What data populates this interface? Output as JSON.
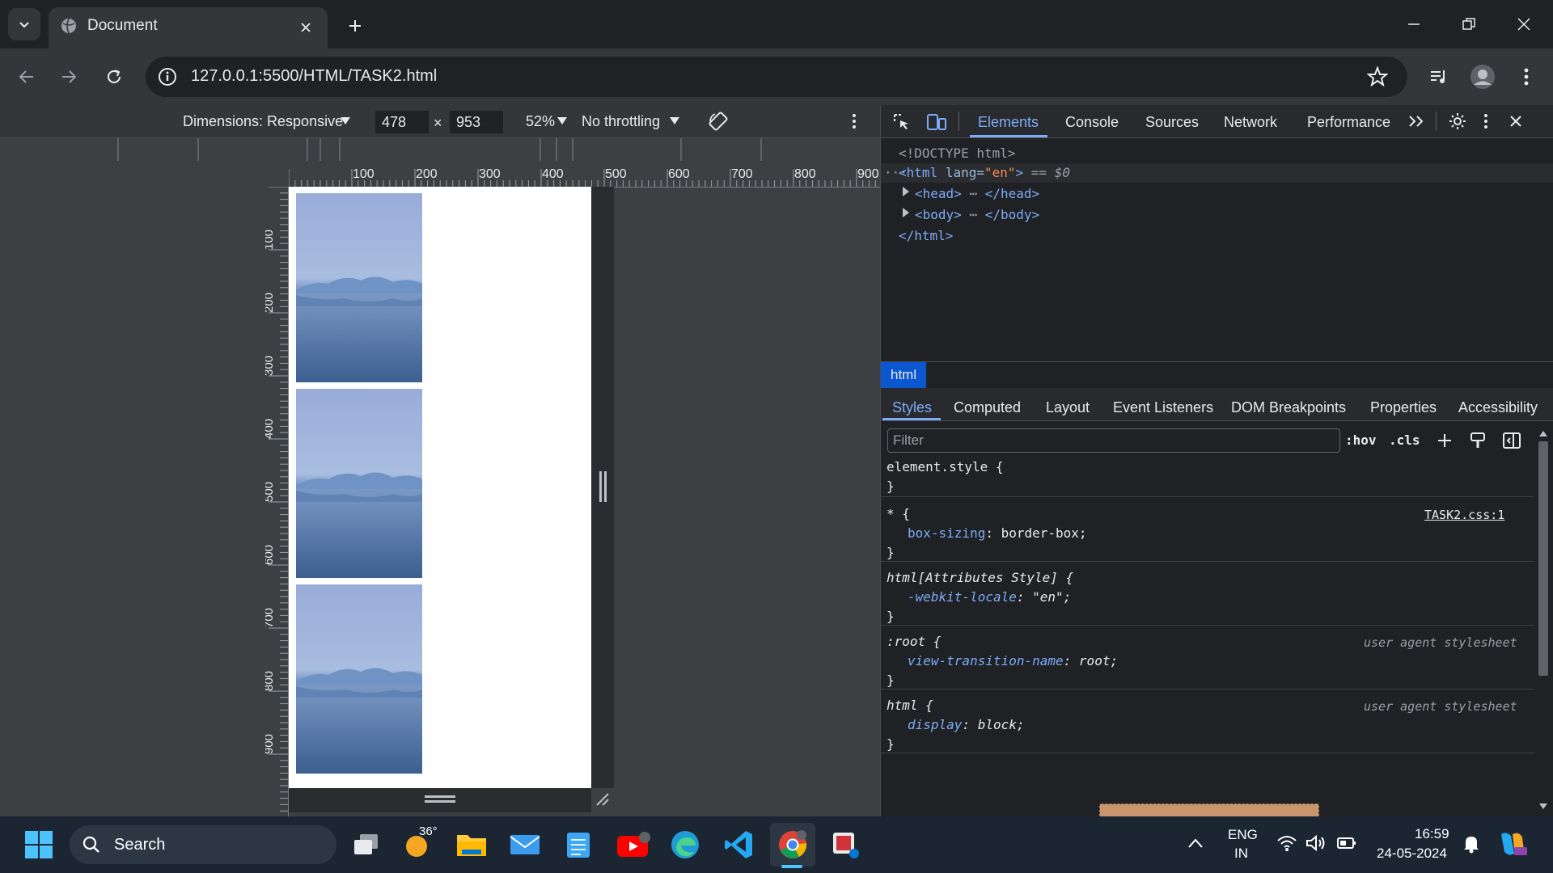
{
  "browser": {
    "tab_title": "Document",
    "url": "127.0.0.1:5500/HTML/TASK2.html"
  },
  "device_toolbar": {
    "dimensions_label": "Dimensions: Responsive",
    "width": "478",
    "times": "×",
    "height": "953",
    "zoom": "52%",
    "throttling": "No throttling"
  },
  "rulers": {
    "top": [
      "100",
      "200",
      "300",
      "400",
      "500",
      "600",
      "700",
      "800",
      "900"
    ],
    "left": [
      "100",
      "200",
      "300",
      "400",
      "500",
      "600",
      "700",
      "800",
      "900"
    ]
  },
  "devtools": {
    "tabs": [
      "Elements",
      "Console",
      "Sources",
      "Network",
      "Performance"
    ],
    "dom": {
      "doctype": "<!DOCTYPE html>",
      "html_open_tag": "<html",
      "html_lang_attr": "lang=",
      "html_lang_val": "\"en\"",
      "html_close_bracket": ">",
      "html_eq": "== $0",
      "head_open": "<head>",
      "head_close": "</head>",
      "body_open": "<body>",
      "body_close": "</body>",
      "html_close": "</html>"
    },
    "breadcrumb": "html",
    "styles_tabs": [
      "Styles",
      "Computed",
      "Layout",
      "Event Listeners",
      "DOM Breakpoints",
      "Properties",
      "Accessibility"
    ],
    "filter_placeholder": "Filter",
    "hov": ":hov",
    ".cls": ".cls",
    "rules": [
      {
        "selector": "element.style {",
        "close": "}"
      },
      {
        "selector": "* {",
        "source": "TASK2.css:1",
        "prop": "box-sizing",
        "value": "border-box;",
        "close": "}"
      },
      {
        "selector": "html[Attributes Style] {",
        "prop": "-webkit-locale",
        "value": "\"en\";",
        "close": "}"
      },
      {
        "selector": ":root {",
        "source": "user agent stylesheet",
        "prop": "view-transition-name",
        "value": "root;",
        "close": "}"
      },
      {
        "selector": "html {",
        "source": "user agent stylesheet",
        "prop": "display",
        "value": "block;",
        "close": "}"
      }
    ]
  },
  "taskbar": {
    "search_label": "Search",
    "weather": "36°",
    "lang_top": "ENG",
    "lang_bottom": "IN",
    "time": "16:59",
    "date": "24-05-2024"
  }
}
